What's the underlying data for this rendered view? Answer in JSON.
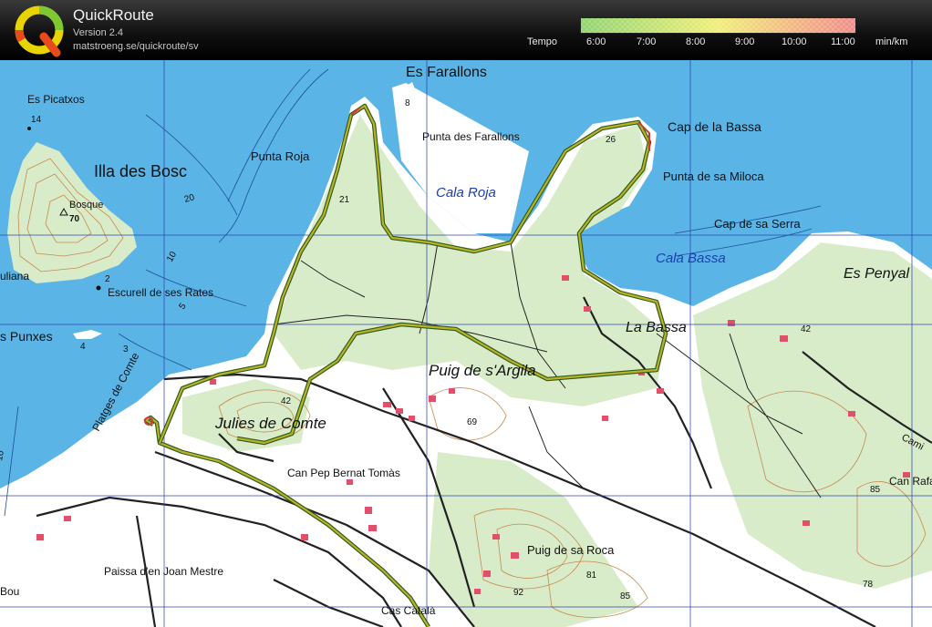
{
  "header": {
    "title": "QuickRoute",
    "version": "Version 2.4",
    "url": "matstroeng.se/quickroute/sv",
    "tempo_label": "Tempo",
    "scale_ticks": [
      "6:00",
      "7:00",
      "8:00",
      "9:00",
      "10:00",
      "11:00"
    ],
    "unit": "min/km",
    "colors": {
      "fast": "#8fd36e",
      "mid": "#f0ee78",
      "slow": "#f08a8a"
    }
  },
  "map": {
    "colors": {
      "sea": "#5bb4e6",
      "land": "#ffffff",
      "vegetation": "#d8ecc9",
      "grid": "#2f45b8",
      "contour": "#c88a50",
      "route": "#b9b223"
    },
    "place_names": [
      "Es Farallons",
      "Es Picatxos",
      "Illa des Bosc",
      "Bosque",
      "Punta Roja",
      "Punta des Farallons",
      "Cala Roja",
      "Cap de la Bassa",
      "Punta de sa Miloca",
      "Cap de sa Serra",
      "Cala Bassa",
      "Es Penyal",
      "La Bassa",
      "Puig de s'Argila",
      "Julies de Comte",
      "Platges de Comte",
      "Escurell de ses Rates",
      "uliana",
      "s Punxes",
      "Can Pep Bernat Tomàs",
      "Puig de sa Roca",
      "Paissa d'en Joan Mestre",
      "Can Rafa",
      "Cas Català",
      "Bou",
      "Cami"
    ],
    "elevations": [
      "14",
      "70",
      "2",
      "4",
      "3",
      "8",
      "21",
      "26",
      "42",
      "69",
      "42",
      "85",
      "81",
      "85",
      "92",
      "78",
      "10",
      "5",
      "20",
      "10"
    ]
  }
}
